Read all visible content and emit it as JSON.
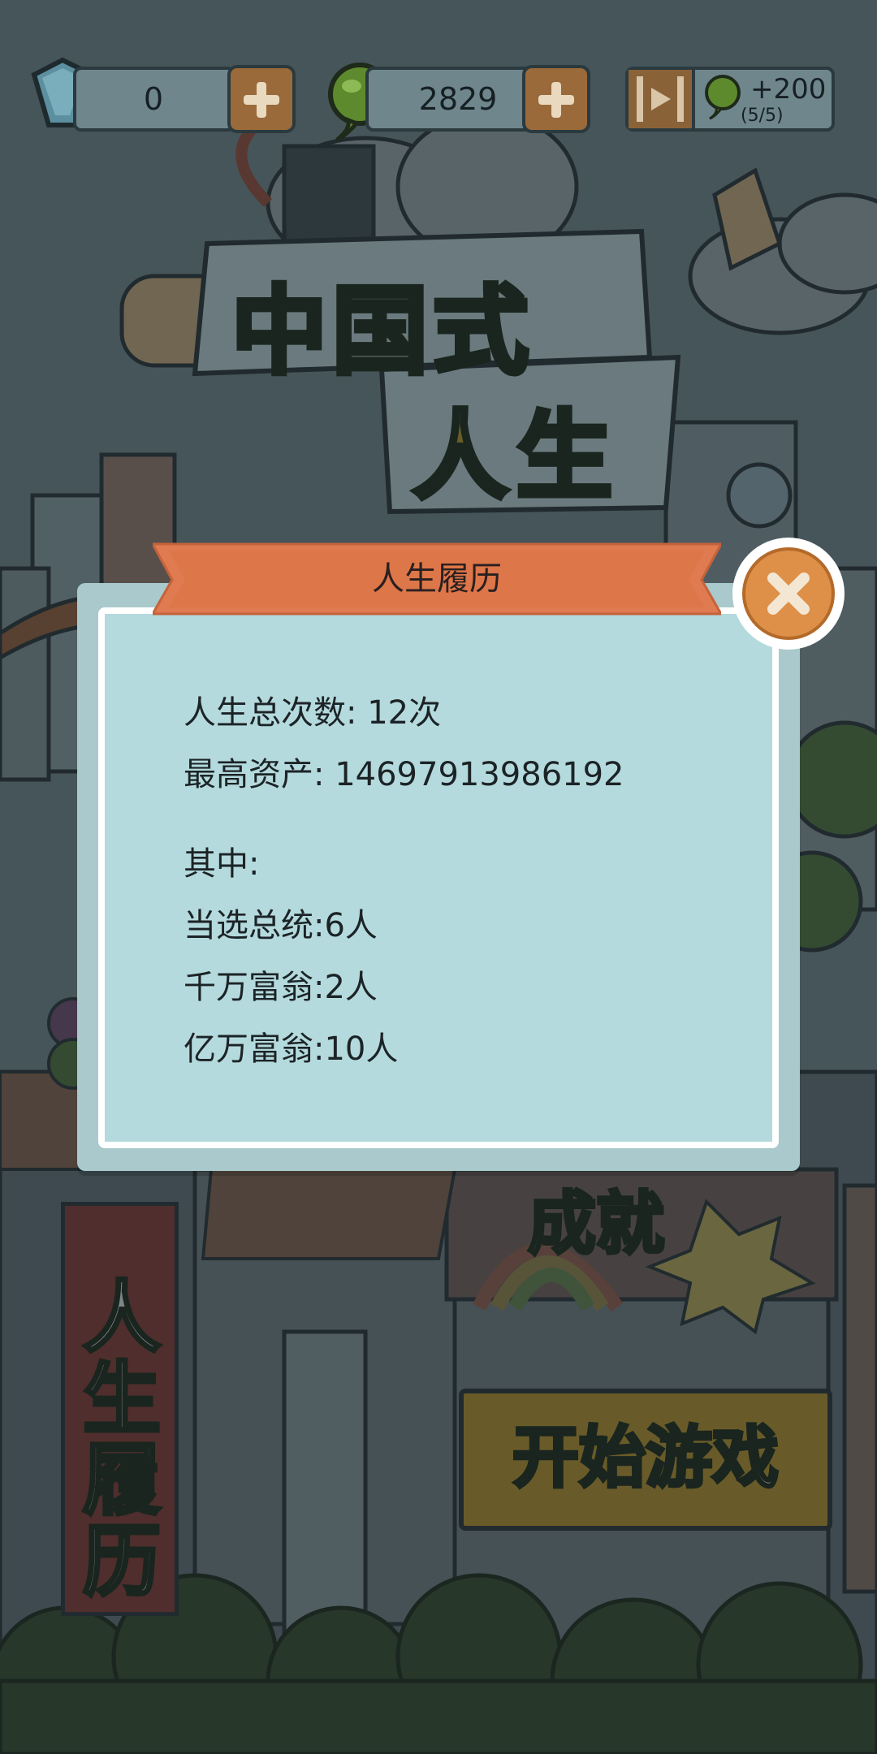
{
  "top_bar": {
    "diamonds": "0",
    "coins": "2829",
    "video_reward": "+200",
    "video_count": "(5/5)",
    "icons": [
      "diamond-icon",
      "coin-icon",
      "video-play-icon"
    ]
  },
  "background": {
    "logo_line1": "中国式",
    "logo_line2": "人生",
    "banner_text": [
      "人",
      "生",
      "履",
      "历"
    ],
    "achievements_sign": "成就",
    "start_button": "开始游戏"
  },
  "modal": {
    "title": "人生履历",
    "total_lives_label": "人生总次数: ",
    "total_lives_value": "12次",
    "max_assets_label": "最高资产: ",
    "max_assets_value": "14697913986192",
    "breakdown_header": "其中:",
    "president_line": "当选总统:6人",
    "ten_million_line": "千万富翁:2人",
    "hundred_million_line": "亿万富翁:10人"
  },
  "colors": {
    "modal_outer": "#a9c9cc",
    "modal_inner": "#b4dadd",
    "ribbon": "#e07a50",
    "close_button": "#de8f48",
    "logo_text": "#6b8a2a",
    "start_sign": "#e0b52a"
  }
}
